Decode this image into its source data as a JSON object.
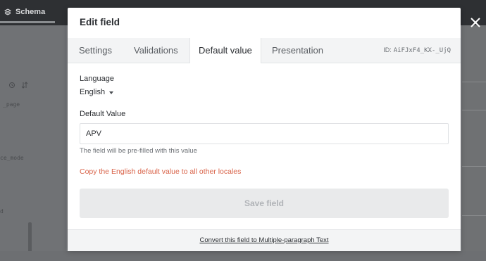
{
  "background": {
    "tab_label": "Schema",
    "left_fragments": [
      "_page",
      "ce_mode",
      "d"
    ]
  },
  "modal": {
    "title": "Edit field",
    "close_icon": "close-icon",
    "tabs": [
      {
        "label": "Settings",
        "active": false
      },
      {
        "label": "Validations",
        "active": false
      },
      {
        "label": "Default value",
        "active": true
      },
      {
        "label": "Presentation",
        "active": false
      }
    ],
    "field_id_label": "ID:",
    "field_id_value": "AiFJxF4_KX-_UjQ",
    "language_label": "Language",
    "language_value": "English",
    "default_value_label": "Default Value",
    "default_value_input": "APV",
    "hint": "The field will be pre-filled with this value",
    "copy_link": "Copy the English default value to all other locales",
    "save_label": "Save field",
    "convert_link": "Convert this field to Multiple-paragraph Text"
  },
  "colors": {
    "accent_link": "#d9644a",
    "overlay": "#777a7d"
  }
}
